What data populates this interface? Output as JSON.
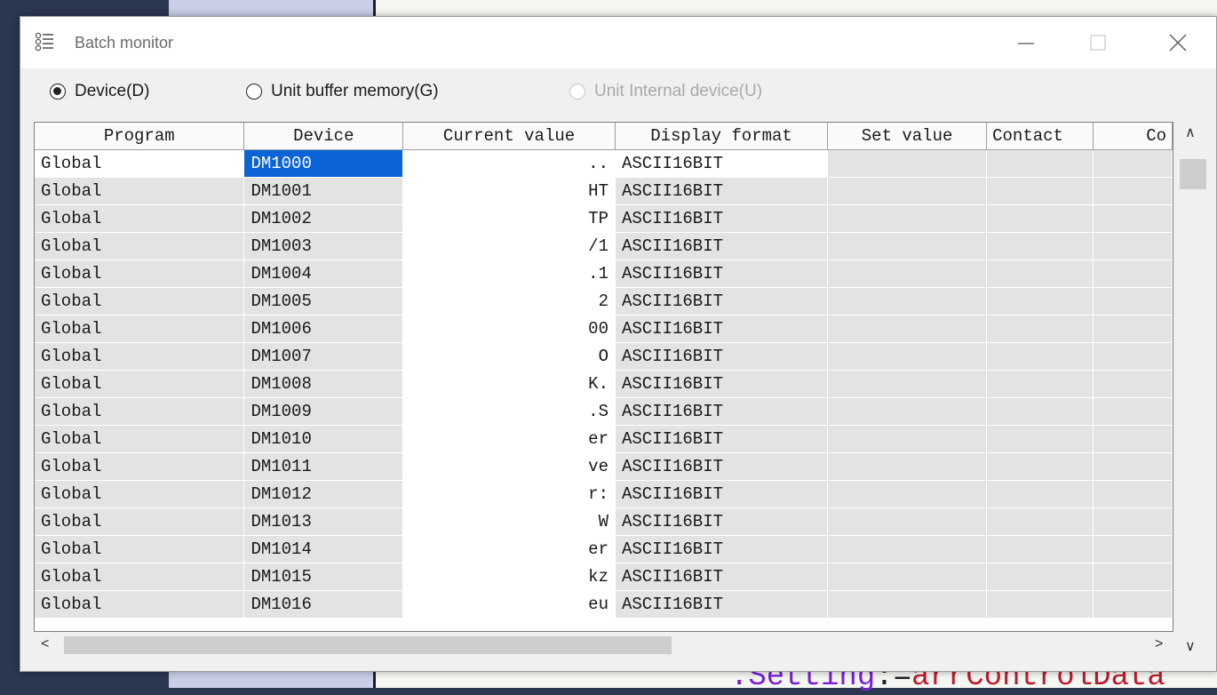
{
  "background": {
    "code_prefix": ".Setting",
    "code_op": ":=",
    "code_id": "arrControlData"
  },
  "window": {
    "title": "Batch monitor",
    "icon": "list-icon",
    "controls": [
      "minimize-icon",
      "maximize-icon",
      "close-icon"
    ]
  },
  "radios": [
    {
      "label": "Device(D)",
      "checked": true,
      "disabled": false
    },
    {
      "label": "Unit buffer memory(G)",
      "checked": false,
      "disabled": false
    },
    {
      "label": "Unit Internal device(U)",
      "checked": false,
      "disabled": true
    }
  ],
  "table": {
    "columns": [
      "Program",
      "Device",
      "Current value",
      "Display format",
      "Set value",
      "Contact",
      "Co"
    ],
    "rows": [
      {
        "program": "Global",
        "device": "DM1000",
        "current": "..",
        "format": "ASCII16BIT"
      },
      {
        "program": "Global",
        "device": "DM1001",
        "current": "HT",
        "format": "ASCII16BIT"
      },
      {
        "program": "Global",
        "device": "DM1002",
        "current": "TP",
        "format": "ASCII16BIT"
      },
      {
        "program": "Global",
        "device": "DM1003",
        "current": "/1",
        "format": "ASCII16BIT"
      },
      {
        "program": "Global",
        "device": "DM1004",
        "current": ".1",
        "format": "ASCII16BIT"
      },
      {
        "program": "Global",
        "device": "DM1005",
        "current": "2",
        "format": "ASCII16BIT"
      },
      {
        "program": "Global",
        "device": "DM1006",
        "current": "00",
        "format": "ASCII16BIT"
      },
      {
        "program": "Global",
        "device": "DM1007",
        "current": "O",
        "format": "ASCII16BIT"
      },
      {
        "program": "Global",
        "device": "DM1008",
        "current": "K.",
        "format": "ASCII16BIT"
      },
      {
        "program": "Global",
        "device": "DM1009",
        "current": ".S",
        "format": "ASCII16BIT"
      },
      {
        "program": "Global",
        "device": "DM1010",
        "current": "er",
        "format": "ASCII16BIT"
      },
      {
        "program": "Global",
        "device": "DM1011",
        "current": "ve",
        "format": "ASCII16BIT"
      },
      {
        "program": "Global",
        "device": "DM1012",
        "current": "r:",
        "format": "ASCII16BIT"
      },
      {
        "program": "Global",
        "device": "DM1013",
        "current": "W",
        "format": "ASCII16BIT"
      },
      {
        "program": "Global",
        "device": "DM1014",
        "current": "er",
        "format": "ASCII16BIT"
      },
      {
        "program": "Global",
        "device": "DM1015",
        "current": "kz",
        "format": "ASCII16BIT"
      },
      {
        "program": "Global",
        "device": "DM1016",
        "current": "eu",
        "format": "ASCII16BIT"
      }
    ],
    "selected_row": 0
  },
  "colors": {
    "selection": "#0a64d8",
    "cell_gray": "#e3e3e3",
    "editor_bg": "#f4f7f2",
    "code_keyword": "#7a1fd6",
    "code_ident": "#c0192b"
  }
}
